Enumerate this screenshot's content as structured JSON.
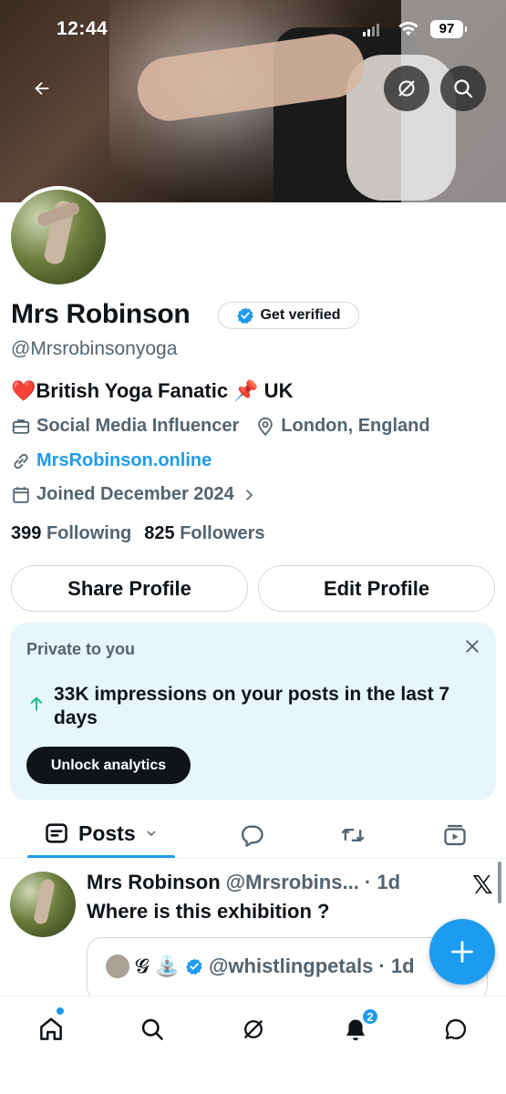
{
  "status_bar": {
    "time": "12:44",
    "battery": "97"
  },
  "profile": {
    "name": "Mrs Robinson",
    "verify_label": "Get verified",
    "handle": "@Mrsrobinsonyoga",
    "bio": "❤️British Yoga Fanatic 📌 UK",
    "category": "Social Media Influencer",
    "location": "London, England",
    "website": "MrsRobinson.online",
    "joined": "Joined December 2024",
    "following_count": "399",
    "following_label": "Following",
    "followers_count": "825",
    "followers_label": "Followers",
    "share_label": "Share Profile",
    "edit_label": "Edit Profile"
  },
  "private_card": {
    "title": "Private to you",
    "text": "33K impressions on your posts in the last 7 days",
    "button": "Unlock analytics"
  },
  "tabs": {
    "posts_label": "Posts"
  },
  "post": {
    "author": "Mrs Robinson",
    "handle": "@Mrsrobins... · 1d",
    "text": "Where is this exhibition ?",
    "quote_prefix": "𝓖 ⛲",
    "quote_handle": "@whistlingpetals · 1d"
  },
  "nav": {
    "notifications_badge": "2"
  },
  "colors": {
    "accent": "#1d9bf0",
    "text": "#0f1419",
    "secondary": "#536471",
    "card_bg": "#e8f5fd"
  },
  "icons": [
    "back-arrow-icon",
    "grok-icon",
    "search-icon",
    "verified-icon",
    "briefcase-icon",
    "location-pin-icon",
    "link-icon",
    "calendar-icon",
    "chevron-right-icon",
    "close-icon",
    "arrow-up-icon",
    "list-icon",
    "chevron-down-icon",
    "reply-icon",
    "retweet-icon",
    "video-icon",
    "x-logo-icon",
    "plus-icon",
    "home-icon",
    "notifications-icon",
    "messages-icon"
  ]
}
